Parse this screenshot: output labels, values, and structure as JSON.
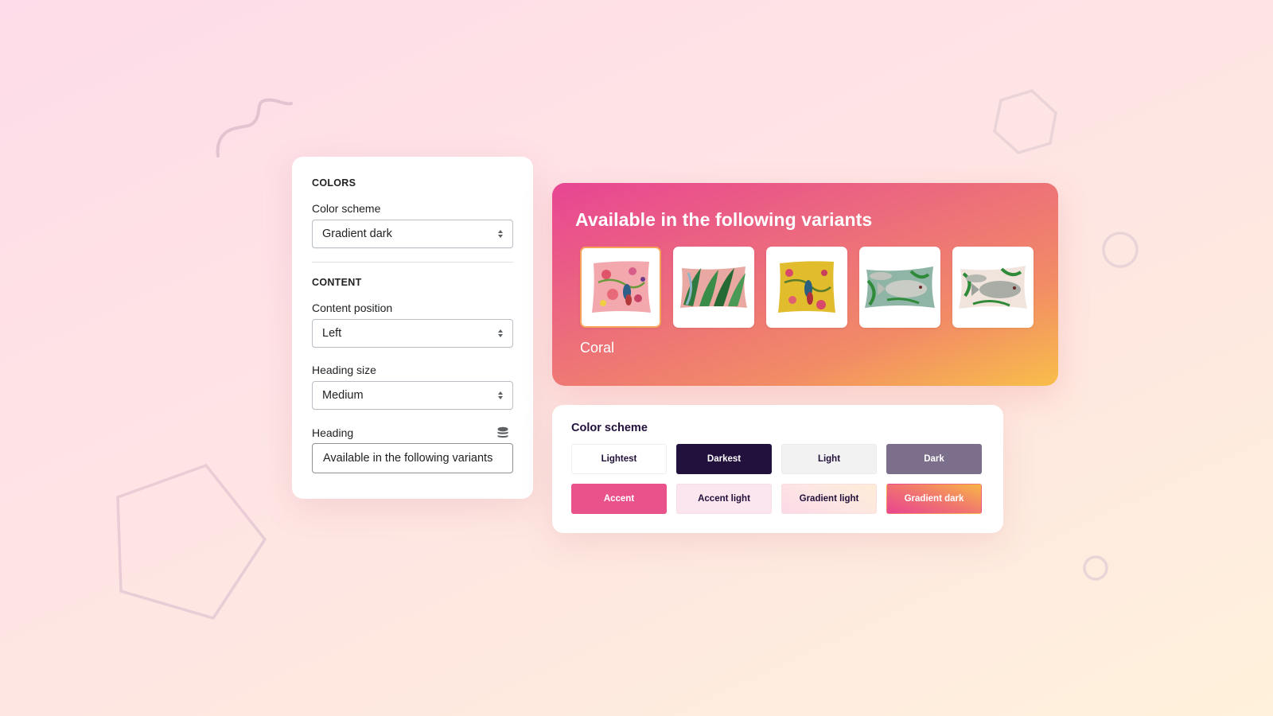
{
  "settings_panel": {
    "colors_section": {
      "title": "COLORS",
      "color_scheme_label": "Color scheme",
      "color_scheme_value": "Gradient dark"
    },
    "content_section": {
      "title": "CONTENT",
      "content_position_label": "Content position",
      "content_position_value": "Left",
      "heading_size_label": "Heading size",
      "heading_size_value": "Medium",
      "heading_label": "Heading",
      "heading_value": "Available in the following variants",
      "dynamic_source_icon": "database-icon"
    }
  },
  "variants_card": {
    "title": "Available in the following variants",
    "selected_variant": "Coral",
    "variants": [
      {
        "name": "Coral",
        "image": "pink floral bird cushion",
        "selected": true
      },
      {
        "name": "",
        "image": "green leaf cushion on pink",
        "selected": false
      },
      {
        "name": "",
        "image": "yellow floral bird cushion",
        "selected": false
      },
      {
        "name": "",
        "image": "fish cushion on sage green",
        "selected": false
      },
      {
        "name": "",
        "image": "fish cushion on cream",
        "selected": false
      }
    ],
    "gradient_colors": [
      "#e84593",
      "#ec6c7c",
      "#f28b66",
      "#f8be4a"
    ],
    "selected_border_color": "#f7a35b"
  },
  "color_scheme_card": {
    "title": "Color scheme",
    "swatches": [
      {
        "label": "Lightest",
        "color": "#ffffff"
      },
      {
        "label": "Darkest",
        "color": "#22103d"
      },
      {
        "label": "Light",
        "color": "#f2f2f3"
      },
      {
        "label": "Dark",
        "color": "#7b6f8c"
      },
      {
        "label": "Accent",
        "color": "#e9528a"
      },
      {
        "label": "Accent light",
        "color": "#fbe5ee"
      },
      {
        "label": "Gradient light",
        "color": "#fde6e3"
      },
      {
        "label": "Gradient dark",
        "color": "#f0756f"
      }
    ]
  },
  "decorations": [
    "squiggle-shape",
    "hexagon-shape",
    "circle-shape-large",
    "pentagon-shape",
    "circle-shape-small"
  ]
}
